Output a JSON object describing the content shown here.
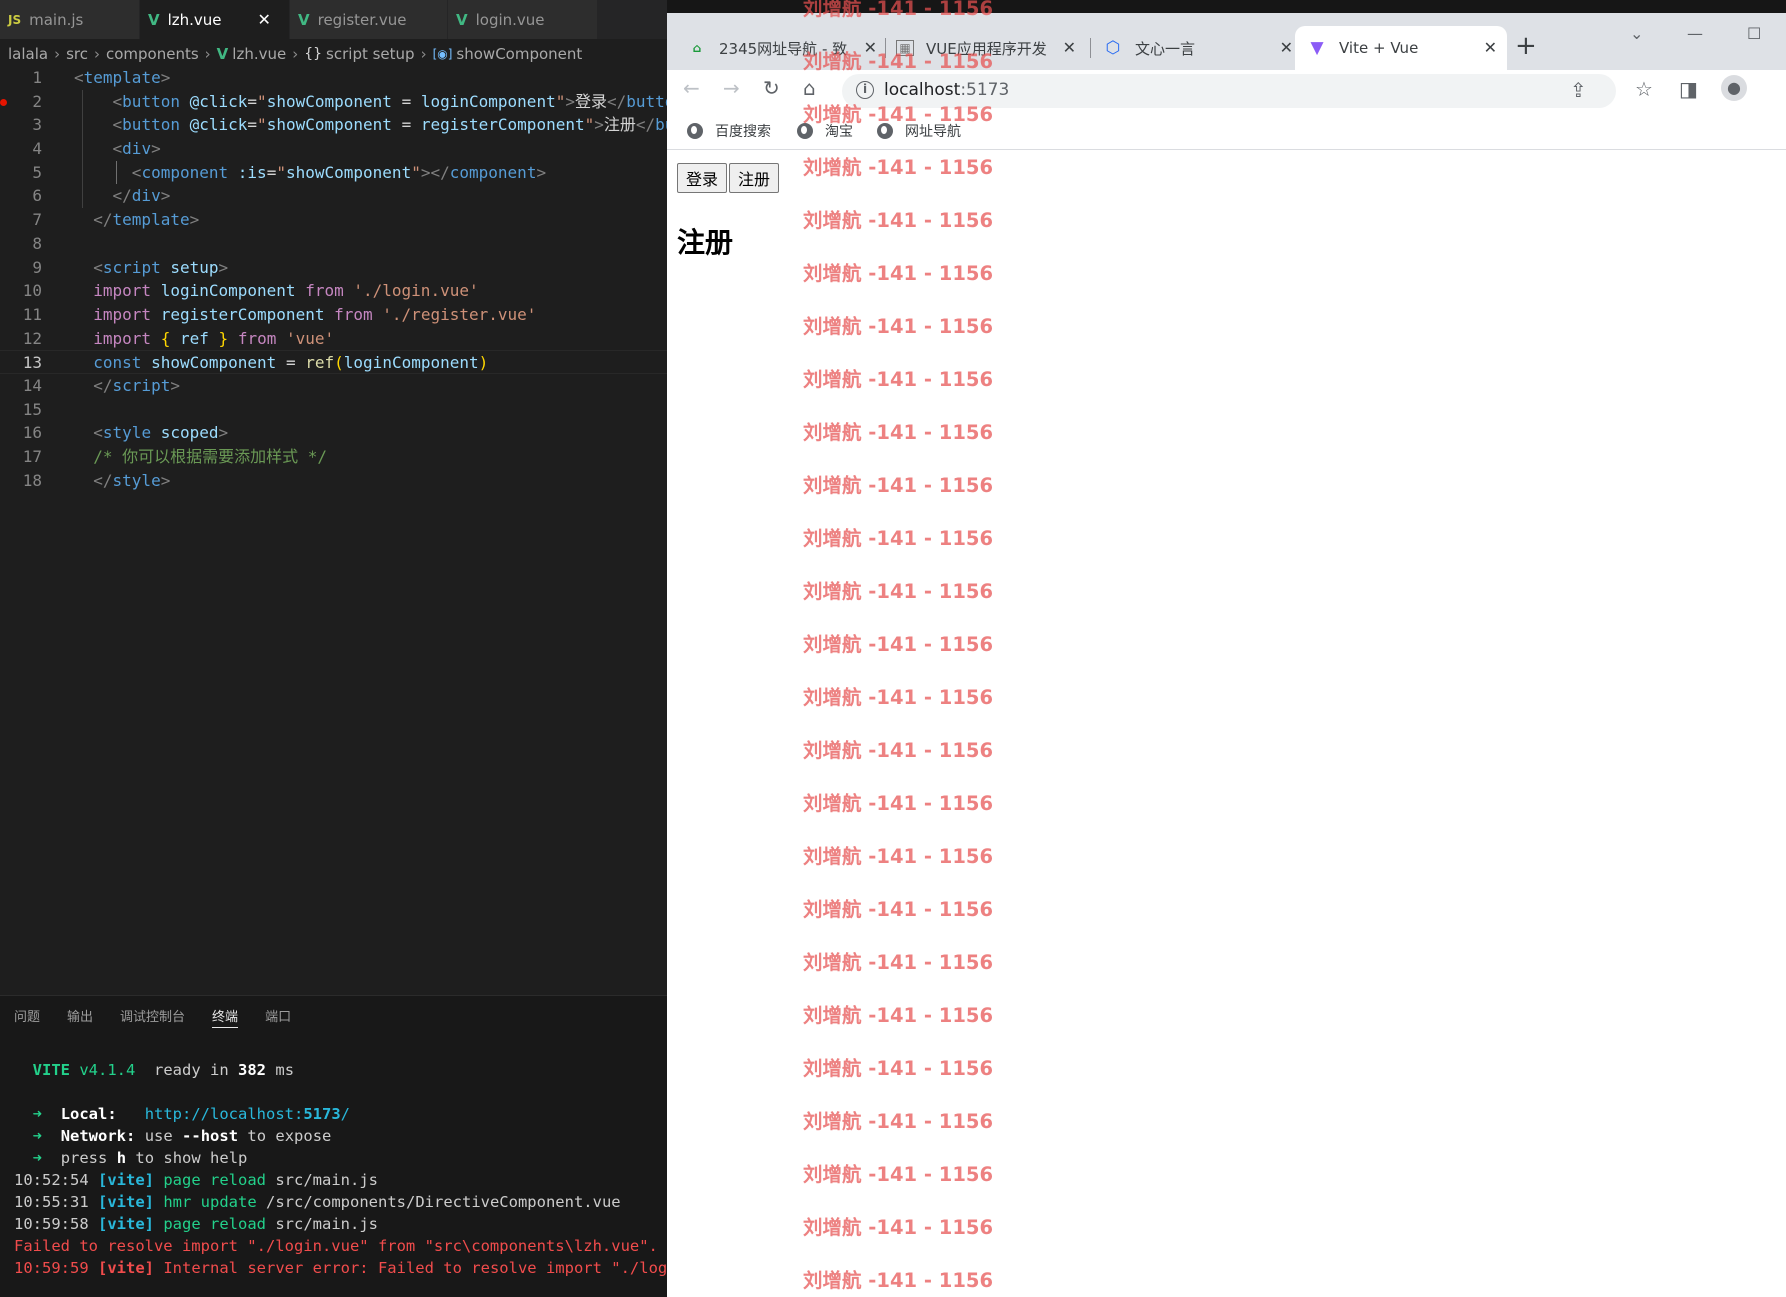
{
  "editor": {
    "tabs": [
      {
        "icon": "JS",
        "label": "main.js",
        "active": false
      },
      {
        "icon": "V",
        "label": "lzh.vue",
        "active": true
      },
      {
        "icon": "V",
        "label": "register.vue",
        "active": false
      },
      {
        "icon": "V",
        "label": "login.vue",
        "active": false
      }
    ],
    "close_glyph": "✕",
    "breadcrumb": [
      "lalala",
      "src",
      "components",
      "lzh.vue",
      "script setup",
      "showComponent"
    ],
    "current_line": 13,
    "line_numbers": [
      "1",
      "2",
      "3",
      "4",
      "5",
      "6",
      "7",
      "8",
      "9",
      "10",
      "11",
      "12",
      "13",
      "14",
      "15",
      "16",
      "17",
      "18"
    ]
  },
  "panel": {
    "tabs": [
      "问题",
      "输出",
      "调试控制台",
      "终端",
      "端口"
    ],
    "active_tab": "终端",
    "terminal": {
      "vite_name": "VITE",
      "vite_version": "v4.1.4",
      "ready_text": "ready in",
      "ready_ms": "382",
      "ms_unit": "ms",
      "local_label": "Local:",
      "local_url_prefix": "http://localhost:",
      "local_port": "5173",
      "local_url_suffix": "/",
      "network_label": "Network:",
      "network_pre": "use",
      "network_flag": "--host",
      "network_post": "to expose",
      "help_pre": "press",
      "help_key": "h",
      "help_post": "to show help",
      "log": [
        {
          "time": "10:52:54",
          "tag": "[vite]",
          "action": "page reload",
          "path": "src/main.js"
        },
        {
          "time": "10:55:31",
          "tag": "[vite]",
          "action": "hmr update",
          "path": "/src/components/DirectiveComponent.vue"
        },
        {
          "time": "10:59:58",
          "tag": "[vite]",
          "action": "page reload",
          "path": "src/main.js"
        }
      ],
      "error_line": "Failed to resolve import \"./login.vue\" from \"src\\components\\lzh.vue\". Doe",
      "error_time": "10:59:59",
      "error_tag": "[vite]",
      "error_msg": "Internal server error: Failed to resolve import \"./login.vue\" from \"src\\components\\lzh.vue\". Does the file exist?"
    }
  },
  "browser": {
    "tabs": [
      {
        "label": "2345网址导航 - 致",
        "favicon": "2345-icon"
      },
      {
        "label": "VUE应用程序开发",
        "favicon": "image-icon"
      },
      {
        "label": "文心一言",
        "favicon": "wenxin-icon"
      },
      {
        "label": "Vite + Vue",
        "favicon": "vite-icon",
        "active": true
      }
    ],
    "new_tab": "+",
    "url_host": "localhost",
    "url_port": ":5173",
    "bookmarks": [
      "百度搜索",
      "淘宝",
      "网址导航"
    ],
    "page": {
      "login_button": "登录",
      "register_button": "注册",
      "heading": "注册"
    }
  },
  "watermark": {
    "text": "刘增航 -141 - 1156",
    "color": "#e65050",
    "repeat": 25
  }
}
